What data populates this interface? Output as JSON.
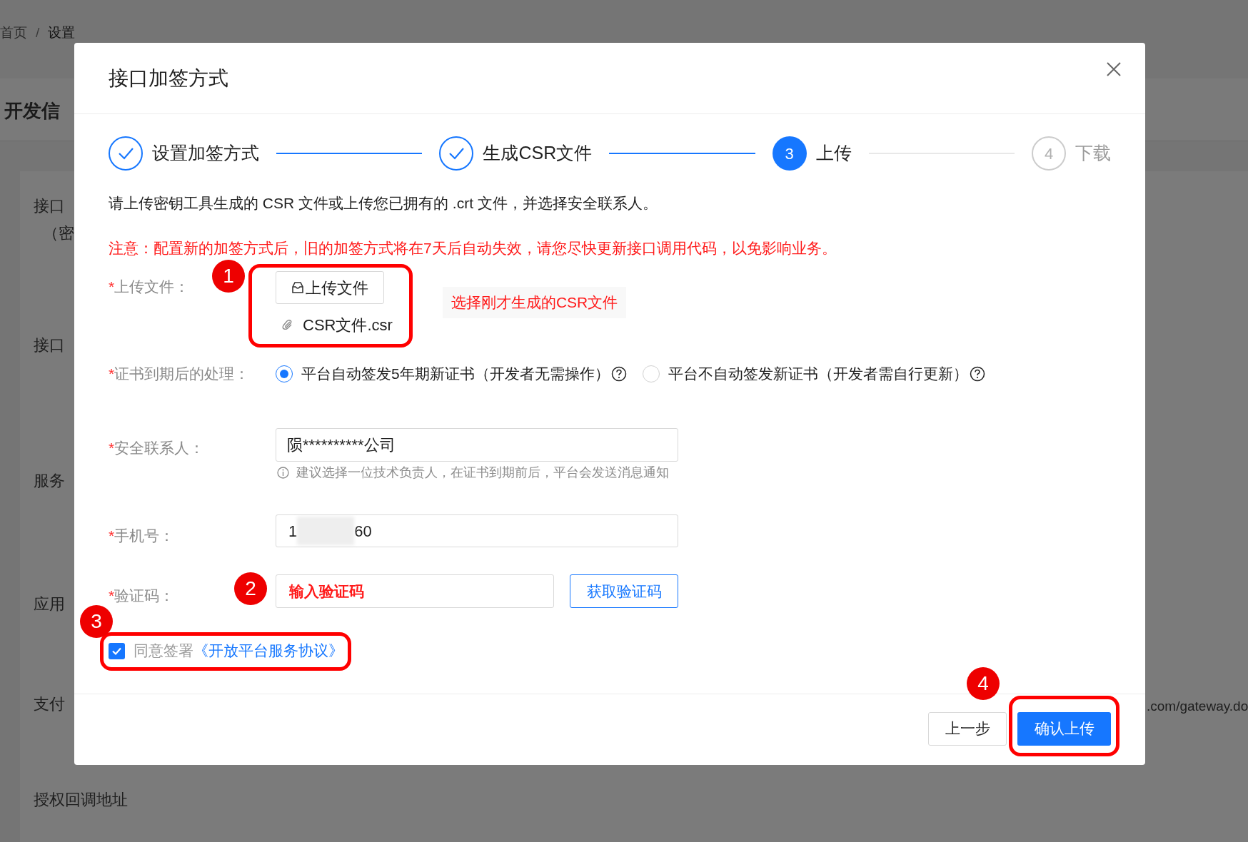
{
  "background_page": {
    "breadcrumb": [
      {
        "label": "首页"
      },
      {
        "label": "设置"
      }
    ],
    "breadcrumb_separator": "/",
    "section_title": "开发信",
    "labels": [
      "接口",
      "（密",
      "接口",
      "服务",
      "应用",
      "支付",
      "授权回调地址"
    ],
    "url_fragment": ".com/gateway.do"
  },
  "dialog": {
    "title": "接口加签方式",
    "steps": [
      {
        "label": "设置加签方式",
        "kind": "done"
      },
      {
        "label": "生成CSR文件",
        "kind": "done"
      },
      {
        "label": "上传",
        "kind": "active",
        "number": "3"
      },
      {
        "label": "下载",
        "kind": "waiting",
        "number": "4"
      }
    ],
    "description": "请上传密钥工具生成的 CSR 文件或上传您已拥有的 .crt 文件，并选择安全联系人。",
    "notice": "注意：配置新的加签方式后，旧的加签方式将在7天后自动失效，请您尽快更新接口调用代码，以免影响业务。",
    "required_mark": "*",
    "upload": {
      "label": "上传文件：",
      "required": true,
      "button": "上传文件",
      "file_name": "CSR文件.csr",
      "hint": "选择刚才生成的CSR文件"
    },
    "expiry": {
      "label": "证书到期后的处理：",
      "required": true,
      "options": [
        {
          "label": "平台自动签发5年期新证书（开发者无需操作）",
          "selected": true
        },
        {
          "label": "平台不自动签发新证书（开发者需自行更新）",
          "selected": false
        }
      ]
    },
    "contact": {
      "label": "安全联系人：",
      "required": true,
      "value": "陨**********公司",
      "help": "建议选择一位技术负责人，在证书到期前后，平台会发送消息通知"
    },
    "phone": {
      "label": "手机号：",
      "required": true,
      "value_start": "1",
      "value_end": "60"
    },
    "code": {
      "label": "验证码：",
      "required": true,
      "value": "输入验证码",
      "button": "获取验证码"
    },
    "agreement": {
      "checked": true,
      "text": "同意签署",
      "link": "《开放平台服务协议》"
    },
    "buttons": [
      {
        "label": "上一步",
        "kind": "secondary"
      },
      {
        "label": "确认上传",
        "kind": "primary"
      }
    ]
  },
  "annotations": [
    {
      "number": "1"
    },
    {
      "number": "2"
    },
    {
      "number": "3"
    },
    {
      "number": "4"
    }
  ]
}
